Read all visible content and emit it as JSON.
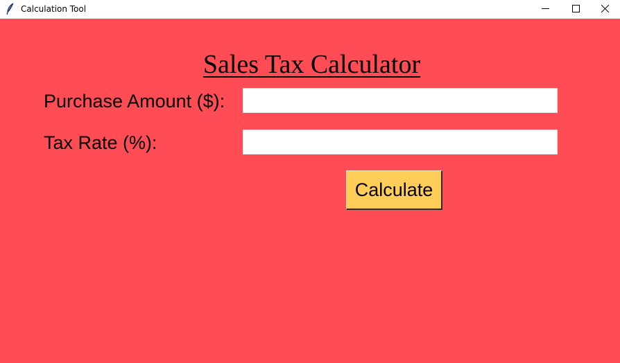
{
  "window": {
    "title": "Calculation Tool",
    "app_icon": "feather-icon",
    "controls": {
      "minimize_icon": "minimize-icon",
      "maximize_icon": "maximize-icon",
      "close_icon": "close-icon"
    }
  },
  "form": {
    "heading": "Sales Tax Calculator",
    "purchase_amount_label": "Purchase Amount ($):",
    "purchase_amount_value": "",
    "tax_rate_label": "Tax Rate (%):",
    "tax_rate_value": "",
    "calculate_label": "Calculate"
  },
  "colors": {
    "background": "#ff4c55",
    "button": "#ffcd58",
    "field": "#ffffff",
    "text": "#000000"
  }
}
